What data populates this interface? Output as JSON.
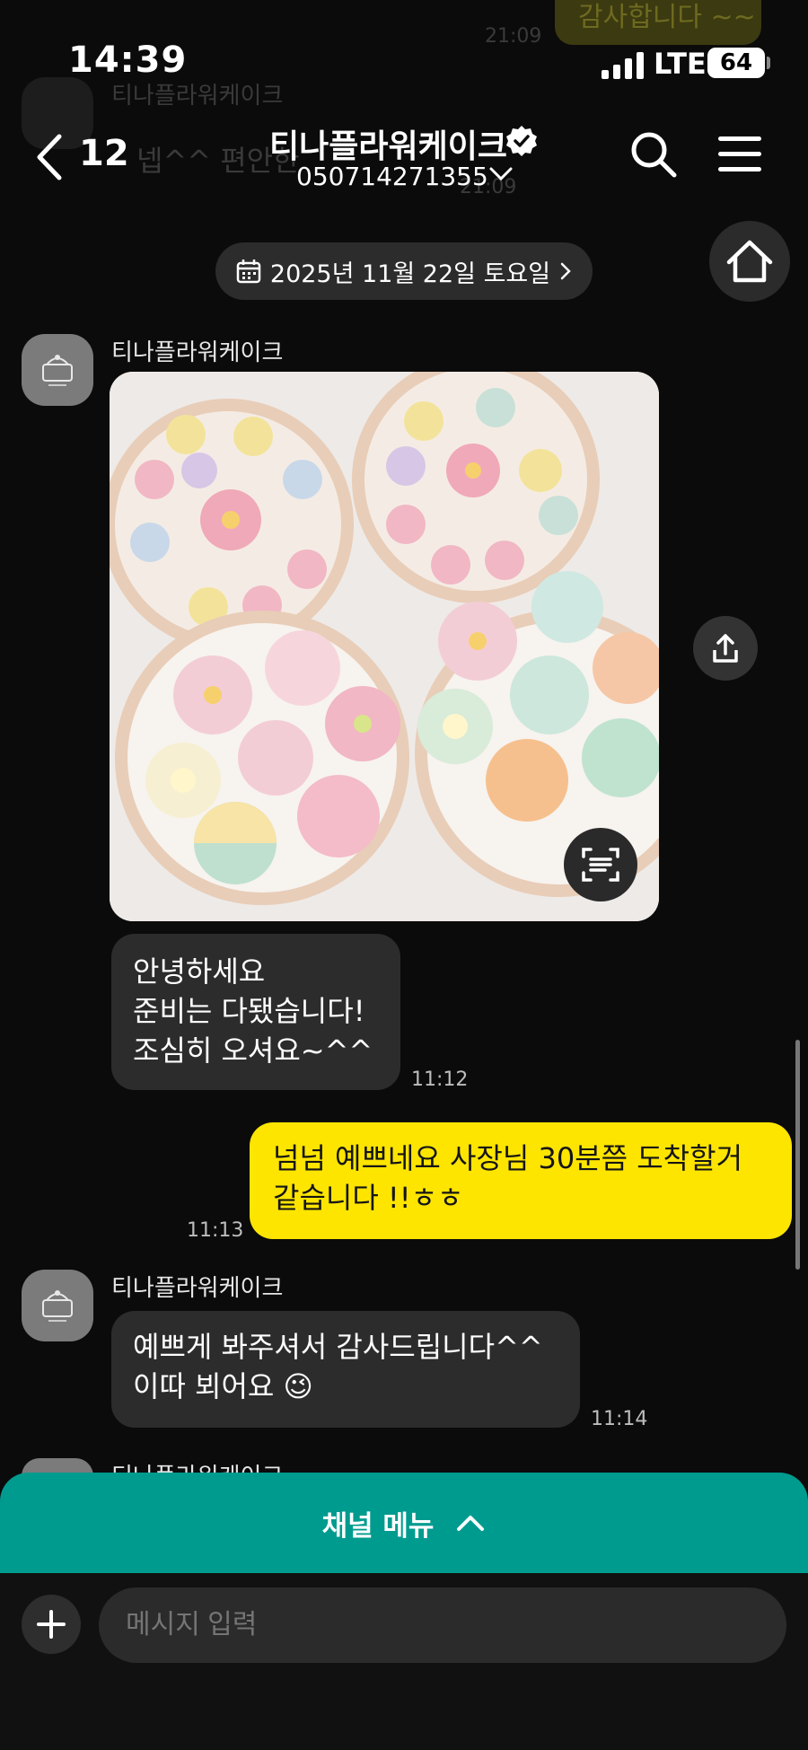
{
  "status_bar": {
    "time": "14:39",
    "network": "LTE",
    "battery": "64"
  },
  "background_residue": {
    "top_text": "감사합니다 ~~",
    "top_time": "21:09",
    "sender": "티나플라워케이크",
    "message": "넵^^ 편안한",
    "time": "21:09"
  },
  "header": {
    "back_icon": "chevron-left-icon",
    "unread_count": "12",
    "title": "티나플라워케이크",
    "verified_icon": "verified-badge-icon",
    "phone": "050714271355",
    "search_icon": "search-icon",
    "menu_icon": "hamburger-menu-icon"
  },
  "date_divider": {
    "label": "2025년 11월 22일 토요일"
  },
  "messages": [
    {
      "sender": "티나플라워케이크",
      "type": "image",
      "alt": "꽃 모양 떡 세트 사진"
    },
    {
      "type": "text",
      "direction": "received",
      "text": "안녕하세요\n준비는 다됐습니다!\n조심히 오셔요~^^",
      "time": "11:12"
    },
    {
      "type": "text",
      "direction": "sent",
      "text": "넘넘 예쁘네요 사장님 30분쯤 도착할거\n같습니다 !!ㅎㅎ",
      "time": "11:13"
    },
    {
      "sender": "티나플라워케이크",
      "type": "text",
      "direction": "received",
      "text": "예쁘게 봐주셔서 감사드립니다^^\n이따 뵈어요 😉",
      "time": "11:14"
    },
    {
      "sender": "티나플라워케이크",
      "partial": true
    }
  ],
  "channel_menu": {
    "label": "채널 메뉴"
  },
  "input": {
    "placeholder": "메시지 입력"
  },
  "colors": {
    "sent_bubble": "#fee500",
    "received_bubble": "#2c2c2c",
    "channel_menu": "#009b8f",
    "background": "#0b0b0b"
  }
}
